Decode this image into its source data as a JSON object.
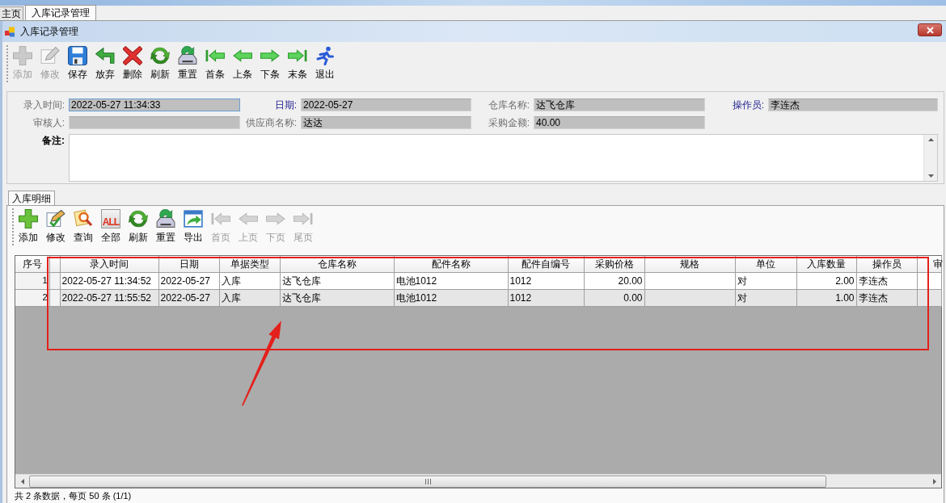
{
  "window_tabs": [
    {
      "label": "主页",
      "selected": false
    },
    {
      "label": "入库记录管理",
      "selected": true
    }
  ],
  "window": {
    "title": "入库记录管理"
  },
  "toolbar": [
    {
      "label": "添加",
      "disabled": true
    },
    {
      "label": "修改",
      "disabled": true
    },
    {
      "label": "保存",
      "disabled": false
    },
    {
      "label": "放弃",
      "disabled": false
    },
    {
      "label": "删除",
      "disabled": false
    },
    {
      "label": "刷新",
      "disabled": false
    },
    {
      "label": "重置",
      "disabled": false
    },
    {
      "label": "首条",
      "disabled": false
    },
    {
      "label": "上条",
      "disabled": false
    },
    {
      "label": "下条",
      "disabled": false
    },
    {
      "label": "末条",
      "disabled": false
    },
    {
      "label": "退出",
      "disabled": false
    }
  ],
  "form": {
    "fields": [
      {
        "label": "录入时间:",
        "value": "2022-05-27 11:34:33",
        "required": false,
        "focused": true
      },
      {
        "label": "日期:",
        "value": "2022-05-27",
        "required": true,
        "focused": false
      },
      {
        "label": "仓库名称:",
        "value": "达飞仓库",
        "required": false,
        "focused": false
      },
      {
        "label": "操作员:",
        "value": "李连杰",
        "required": true,
        "focused": false
      },
      {
        "label": "审核人:",
        "required": false,
        "focused": false
      },
      {
        "label": "供应商名称:",
        "value": "达达",
        "required": false,
        "focused": false
      },
      {
        "label": "采购金额:",
        "value": "40.00",
        "required": false,
        "focused": false
      }
    ],
    "memo": {
      "label": "备注:"
    }
  },
  "detail_tabs": [
    {
      "label": "入库明细",
      "selected": true
    }
  ],
  "detail_toolbar": [
    {
      "label": "添加",
      "disabled": false
    },
    {
      "label": "修改",
      "disabled": false
    },
    {
      "label": "查询",
      "disabled": false
    },
    {
      "label": "全部",
      "disabled": false,
      "icon_text": "ALL"
    },
    {
      "label": "刷新",
      "disabled": false
    },
    {
      "label": "重置",
      "disabled": false
    },
    {
      "label": "导出",
      "disabled": false
    },
    {
      "label": "首页",
      "disabled": true
    },
    {
      "label": "上页",
      "disabled": true
    },
    {
      "label": "下页",
      "disabled": true
    },
    {
      "label": "尾页",
      "disabled": true
    }
  ],
  "table": {
    "row_header": "序号",
    "columns": [
      {
        "label": "录入时间",
        "kind": "text"
      },
      {
        "label": "日期",
        "kind": "text"
      },
      {
        "label": "单据类型",
        "kind": "text"
      },
      {
        "label": "仓库名称",
        "kind": "text"
      },
      {
        "label": "配件名称",
        "kind": "text"
      },
      {
        "label": "配件自编号",
        "kind": "text"
      },
      {
        "label": "采购价格",
        "kind": "number"
      },
      {
        "label": "规格",
        "kind": "text"
      },
      {
        "label": "单位",
        "kind": "text"
      },
      {
        "label": "入库数量",
        "kind": "number"
      },
      {
        "label": "操作员",
        "kind": "text"
      },
      {
        "label": "审",
        "kind": "text"
      }
    ],
    "rows": [
      {
        "number": "1",
        "cells": [
          "2022-05-27 11:34:52",
          "2022-05-27",
          "入库",
          "达飞仓库",
          "电池1012",
          "1012",
          "20.00",
          "",
          "对",
          "2.00",
          "李连杰"
        ]
      },
      {
        "number": "2",
        "cells": [
          "2022-05-27 11:55:52",
          "2022-05-27",
          "入库",
          "达飞仓库",
          "电池1012",
          "1012",
          "0.00",
          "",
          "对",
          "1.00",
          "李连杰"
        ]
      }
    ]
  },
  "status_bar": "共 2 条数据，每页 50 条 (1/1)"
}
